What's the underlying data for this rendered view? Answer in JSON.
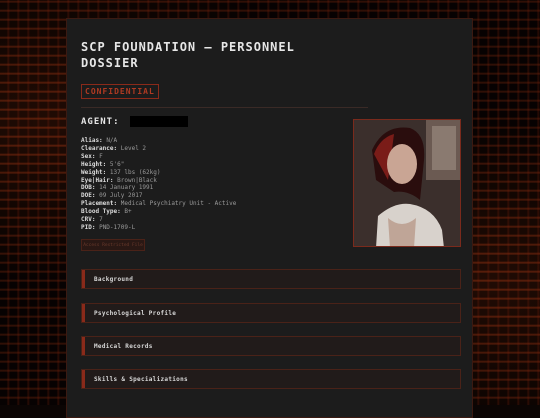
{
  "header": {
    "title": "SCP FOUNDATION — PERSONNEL DOSSIER",
    "badge": "CONFIDENTIAL"
  },
  "agent": {
    "label": "AGENT:",
    "fields": [
      {
        "key": "Alias:",
        "value": "N/A"
      },
      {
        "key": "Clearance:",
        "value": "Level 2"
      },
      {
        "key": "Sex:",
        "value": "F"
      },
      {
        "key": "Height:",
        "value": "5'6\""
      },
      {
        "key": "Weight:",
        "value": "137 lbs (62kg)"
      },
      {
        "key": "Eye|Hair:",
        "value": "Brown|Black"
      },
      {
        "key": "DOB:",
        "value": "14 January 1991"
      },
      {
        "key": "DOE:",
        "value": "09 July 2017"
      },
      {
        "key": "Placement:",
        "value": "Medical Psychiatry Unit - Active"
      },
      {
        "key": "Blood Type:",
        "value": "B+"
      },
      {
        "key": "CRV:",
        "value": "7"
      },
      {
        "key": "PID:",
        "value": "PND-1709-L"
      }
    ]
  },
  "access_button": "Access Restricted File",
  "sections": [
    {
      "label": "Background"
    },
    {
      "label": "Psychological Profile"
    },
    {
      "label": "Medical Records"
    },
    {
      "label": "Skills & Specializations"
    }
  ],
  "colors": {
    "accent": "#8a2a1a",
    "panel": "#1c1c1c",
    "text": "#e6e6e6"
  }
}
